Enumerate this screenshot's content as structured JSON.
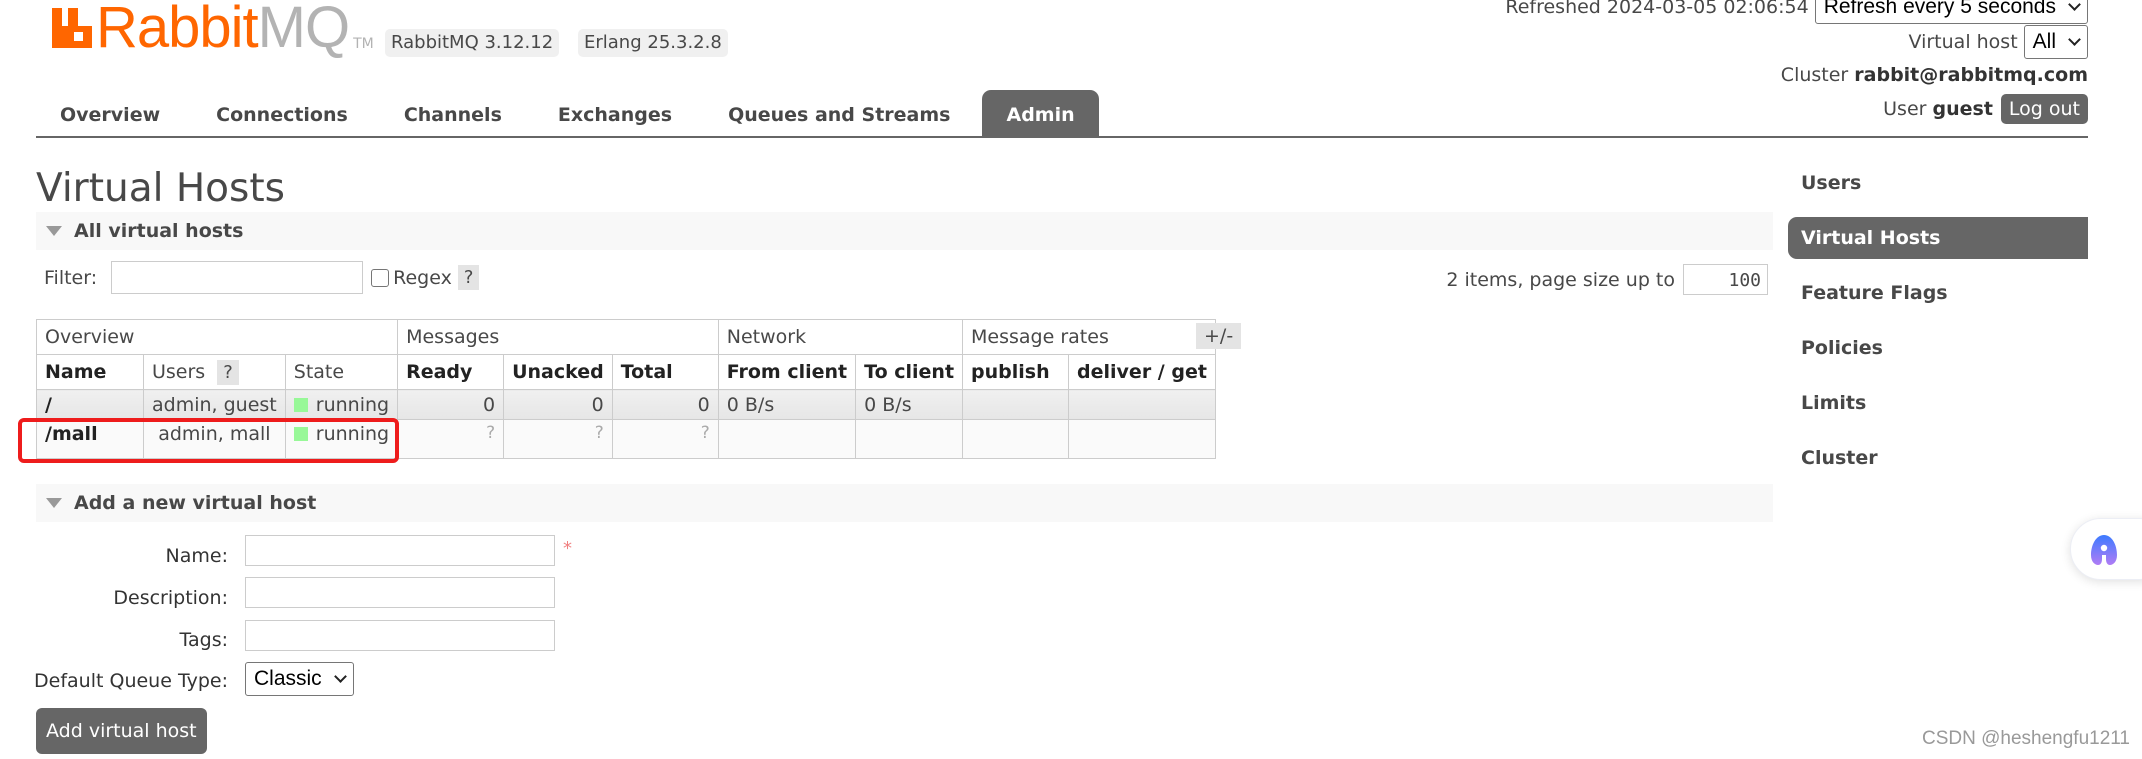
{
  "header": {
    "logo_text_orange": "Rabbit",
    "logo_text_gray": "MQ",
    "logo_tm": "TM",
    "rabbitmq_version": "RabbitMQ 3.12.12",
    "erlang_version": "Erlang 25.3.2.8",
    "refreshed_label": "Refreshed 2024-03-05 02:06:54",
    "refresh_select_value": "Refresh every 5 seconds",
    "virtual_host_label": "Virtual host",
    "virtual_host_value": "All",
    "cluster_label": "Cluster",
    "cluster_value": "rabbit@rabbitmq.com",
    "user_label": "User",
    "user_value": "guest",
    "logout_label": "Log out"
  },
  "nav": {
    "tabs": [
      {
        "label": "Overview",
        "active": false
      },
      {
        "label": "Connections",
        "active": false
      },
      {
        "label": "Channels",
        "active": false
      },
      {
        "label": "Exchanges",
        "active": false
      },
      {
        "label": "Queues and Streams",
        "active": false
      },
      {
        "label": "Admin",
        "active": true
      }
    ]
  },
  "page": {
    "title": "Virtual Hosts"
  },
  "all_vhosts": {
    "section_title": "All virtual hosts",
    "filter_label": "Filter:",
    "filter_value": "",
    "regex_label": "Regex",
    "regex_checked": false,
    "help_label": "?",
    "items_summary": "2 items, page size up to",
    "page_size": "100",
    "columns_toggle": "+/-",
    "table": {
      "groups": [
        "Overview",
        "Messages",
        "Network",
        "Message rates"
      ],
      "columns": [
        "Name",
        "Users",
        "State",
        "Ready",
        "Unacked",
        "Total",
        "From client",
        "To client",
        "publish",
        "deliver / get"
      ],
      "users_help": "?",
      "rows": [
        {
          "name": "/",
          "users": "admin, guest",
          "state": "running",
          "ready": "0",
          "unacked": "0",
          "total": "0",
          "from_client": "0 B/s",
          "to_client": "0 B/s",
          "publish": "",
          "deliver_get": ""
        },
        {
          "name": "/mall",
          "users": "admin, mall",
          "state": "running",
          "ready": "?",
          "unacked": "?",
          "total": "?",
          "from_client": "",
          "to_client": "",
          "publish": "",
          "deliver_get": "",
          "highlighted": true
        }
      ]
    },
    "state_color": "#98f898",
    "highlight_color": "#ee1c1c"
  },
  "add_vhost": {
    "section_title": "Add a new virtual host",
    "name_label": "Name:",
    "name_value": "",
    "required_mark": "*",
    "description_label": "Description:",
    "description_value": "",
    "tags_label": "Tags:",
    "tags_value": "",
    "queue_type_label": "Default Queue Type:",
    "queue_type_value": "Classic",
    "submit_label": "Add virtual host"
  },
  "sidebar": {
    "items": [
      {
        "label": "Users",
        "active": false
      },
      {
        "label": "Virtual Hosts",
        "active": true
      },
      {
        "label": "Feature Flags",
        "active": false
      },
      {
        "label": "Policies",
        "active": false
      },
      {
        "label": "Limits",
        "active": false
      },
      {
        "label": "Cluster",
        "active": false
      }
    ]
  },
  "overlay": {
    "assistant_icon": "assistant-icon",
    "watermark": "CSDN @heshengfu1211"
  },
  "colors": {
    "brand_orange": "#ff6600",
    "active_tab": "#666666"
  }
}
